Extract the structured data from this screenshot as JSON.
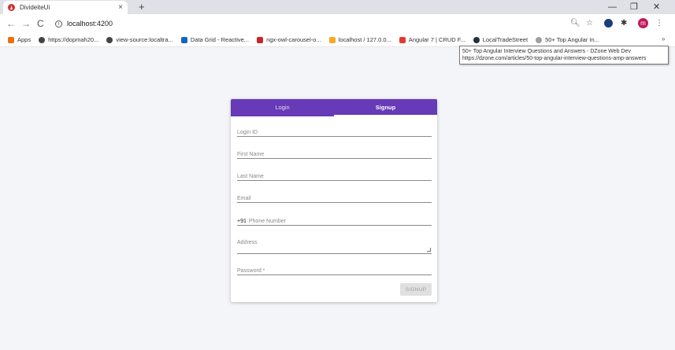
{
  "browser": {
    "tab_title": "DivideiteUi",
    "tab_close": "×",
    "new_tab": "+",
    "url": "localhost:4200",
    "bookmarks": [
      {
        "label": "Apps",
        "icon": "apps-grid-icon",
        "color": "#e8710a"
      },
      {
        "label": "https://dopmah20...",
        "icon": "globe-icon",
        "color": "#444444"
      },
      {
        "label": "view-source:localtra...",
        "icon": "globe-icon",
        "color": "#444444"
      },
      {
        "label": "Data Grid - Reactive...",
        "icon": "grid-icon",
        "color": "#1565c0"
      },
      {
        "label": "ngx-owl-carousel-o...",
        "icon": "owl-icon",
        "color": "#c62828"
      },
      {
        "label": "localhost / 127.0.0...",
        "icon": "phpmyadmin-icon",
        "color": "#f9a825"
      },
      {
        "label": "Angular 7 | CRUD F...",
        "icon": "youtube-icon",
        "color": "#e53935"
      },
      {
        "label": "LocalTradeStreet",
        "icon": "angular-icon",
        "color": "#263238"
      },
      {
        "label": "50+ Top Angular In...",
        "icon": "dzone-icon",
        "color": "#9e9e9e"
      }
    ],
    "bookmarks_more": "»",
    "avatar_letter": "m",
    "tooltip": {
      "title": "50+ Top Angular Interview Questions and Answers - DZone Web Dev",
      "url": "https://dzone.com/articles/50-top-angular-interview-questions-amp-answers"
    }
  },
  "form": {
    "tabs": [
      {
        "label": "Login",
        "active": false
      },
      {
        "label": "Signup",
        "active": true
      }
    ],
    "fields": {
      "login_id": "Login ID",
      "first_name": "First Name",
      "last_name": "Last Name",
      "email": "Email",
      "phone_prefix": "+91",
      "phone": "Phone Number",
      "address": "Address",
      "password": "Password *"
    },
    "submit_label": "SIGNUP"
  },
  "colors": {
    "tab_bar": "#673ab7",
    "page_background": "#f4f5f8"
  }
}
